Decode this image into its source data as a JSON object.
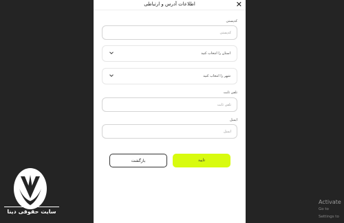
{
  "modal": {
    "title": "اطلاعات آدرس و ارتباطی",
    "close_glyph": "✕"
  },
  "form": {
    "postal_code": {
      "label": "کدپستی",
      "placeholder": "کدپستی",
      "value": ""
    },
    "province": {
      "selected": "استان را انتخاب کنید"
    },
    "city": {
      "selected": "شهر را انتخاب کنید"
    },
    "phone": {
      "label": "تلفن ثابت",
      "placeholder": "تلفن ثابت",
      "value": ""
    },
    "email": {
      "label": "ایمیل",
      "placeholder": "ایمیل",
      "value": ""
    }
  },
  "actions": {
    "back_label": "بازگشت",
    "confirm_label": "تایید"
  },
  "colors": {
    "backdrop": "#242424",
    "confirm_button": "#d8fb0f"
  },
  "branding": {
    "caption": "سایت حقوقی دینا",
    "logo_icon": "leaf-v-icon"
  },
  "watermark": {
    "line1": "Activate",
    "line2": "Go to Settings to"
  }
}
